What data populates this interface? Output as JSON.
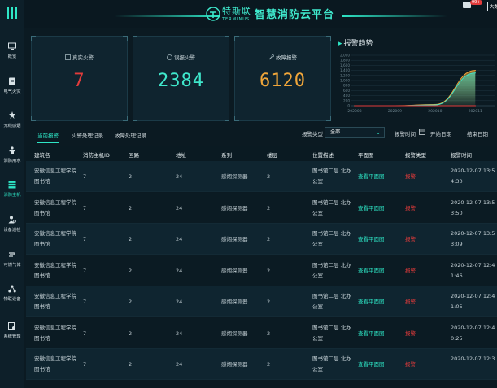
{
  "header": {
    "brand_cn": "特斯联",
    "brand_en": "TERMINUS",
    "title": "智慧消防云平台",
    "badge": "99+",
    "big_data_btn": "大数据 云分析"
  },
  "sidebar": {
    "items": [
      {
        "label": "概览",
        "icon": "monitor-icon"
      },
      {
        "label": "电气火灾",
        "icon": "plug-icon"
      },
      {
        "label": "无线感烟",
        "icon": "smoke-detector-icon"
      },
      {
        "label": "消防用水",
        "icon": "hydrant-icon"
      },
      {
        "label": "消防主机",
        "icon": "server-icon"
      },
      {
        "label": "设备巡检",
        "icon": "inspector-icon"
      },
      {
        "label": "可燃气体",
        "icon": "gas-icon"
      },
      {
        "label": "物联设备",
        "icon": "iot-network-icon"
      },
      {
        "label": "系统管理",
        "icon": "settings-doc-icon"
      }
    ],
    "active_index": 4
  },
  "stats": {
    "real_fire": {
      "label": "真实火警",
      "value": "7",
      "color": "#e23b3b"
    },
    "false_alarm": {
      "label": "误报火警",
      "value": "2384",
      "color": "#3fe8cc"
    },
    "fault_alarm": {
      "label": "故障报警",
      "value": "6120",
      "color": "#f0a63a"
    }
  },
  "trend": {
    "title": "报警趋势",
    "chart_data": {
      "type": "area",
      "title": "报警趋势",
      "x": [
        "202008",
        "202009",
        "202010",
        "202011"
      ],
      "ylim": [
        0,
        2000
      ],
      "yticks": [
        "2,000",
        "1,800",
        "1,600",
        "1,400",
        "1,200",
        "1,000",
        "800",
        "600",
        "400",
        "200",
        "0"
      ],
      "series": [
        {
          "color": "#f0a63a",
          "values": [
            0,
            0,
            50,
            1400
          ]
        },
        {
          "color": "#3fe8cc",
          "values": [
            0,
            0,
            30,
            1300
          ]
        },
        {
          "color": "#e23b3b",
          "values": [
            0,
            0,
            0,
            0
          ]
        }
      ],
      "grid": true
    }
  },
  "tabs": [
    "当前报警",
    "火警处理记录",
    "故障处理记录"
  ],
  "filters": {
    "type_label": "报警类型",
    "type_value": "全部",
    "time_label": "报警时间",
    "start_date": "开始日期",
    "separator": "—",
    "end_date": "结束日期"
  },
  "table": {
    "columns": [
      "建筑名",
      "消防主机ID",
      "回路",
      "地址",
      "系列",
      "楼层",
      "位置描述",
      "平面图",
      "报警类型",
      "报警时间"
    ],
    "rows": [
      {
        "building_1": "安徽信息工程学院",
        "building_2": "图书馆",
        "host_id": "7",
        "loop": "2",
        "address": "24",
        "series": "感烟探测器",
        "floor": "2",
        "location_1": "图书馆二层 北办",
        "location_2": "公室",
        "plan": "查看平面图",
        "alarm_type": "报警",
        "time_1": "2020-12-07 13:5",
        "time_2": "4:30"
      },
      {
        "building_1": "安徽信息工程学院",
        "building_2": "图书馆",
        "host_id": "7",
        "loop": "2",
        "address": "24",
        "series": "感烟探测器",
        "floor": "2",
        "location_1": "图书馆二层 北办",
        "location_2": "公室",
        "plan": "查看平面图",
        "alarm_type": "报警",
        "time_1": "2020-12-07 13:5",
        "time_2": "3:50"
      },
      {
        "building_1": "安徽信息工程学院",
        "building_2": "图书馆",
        "host_id": "7",
        "loop": "2",
        "address": "24",
        "series": "感烟探测器",
        "floor": "2",
        "location_1": "图书馆二层 北办",
        "location_2": "公室",
        "plan": "查看平面图",
        "alarm_type": "报警",
        "time_1": "2020-12-07 13:5",
        "time_2": "3:09"
      },
      {
        "building_1": "安徽信息工程学院",
        "building_2": "图书馆",
        "host_id": "7",
        "loop": "2",
        "address": "24",
        "series": "感烟探测器",
        "floor": "2",
        "location_1": "图书馆二层 北办",
        "location_2": "公室",
        "plan": "查看平面图",
        "alarm_type": "报警",
        "time_1": "2020-12-07 12:4",
        "time_2": "1:46"
      },
      {
        "building_1": "安徽信息工程学院",
        "building_2": "图书馆",
        "host_id": "7",
        "loop": "2",
        "address": "24",
        "series": "感烟探测器",
        "floor": "2",
        "location_1": "图书馆二层 北办",
        "location_2": "公室",
        "plan": "查看平面图",
        "alarm_type": "报警",
        "time_1": "2020-12-07 12:4",
        "time_2": "1:05"
      },
      {
        "building_1": "安徽信息工程学院",
        "building_2": "图书馆",
        "host_id": "7",
        "loop": "2",
        "address": "24",
        "series": "感烟探测器",
        "floor": "2",
        "location_1": "图书馆二层 北办",
        "location_2": "公室",
        "plan": "查看平面图",
        "alarm_type": "报警",
        "time_1": "2020-12-07 12:4",
        "time_2": "0:25"
      },
      {
        "building_1": "安徽信息工程学院",
        "building_2": "图书馆",
        "host_id": "7",
        "loop": "2",
        "address": "24",
        "series": "感烟探测器",
        "floor": "2",
        "location_1": "图书馆二层 北办",
        "location_2": "公室",
        "plan": "查看平面图",
        "alarm_type": "报警",
        "time_1": "2020-12-07 12:3",
        "time_2": ""
      }
    ]
  }
}
